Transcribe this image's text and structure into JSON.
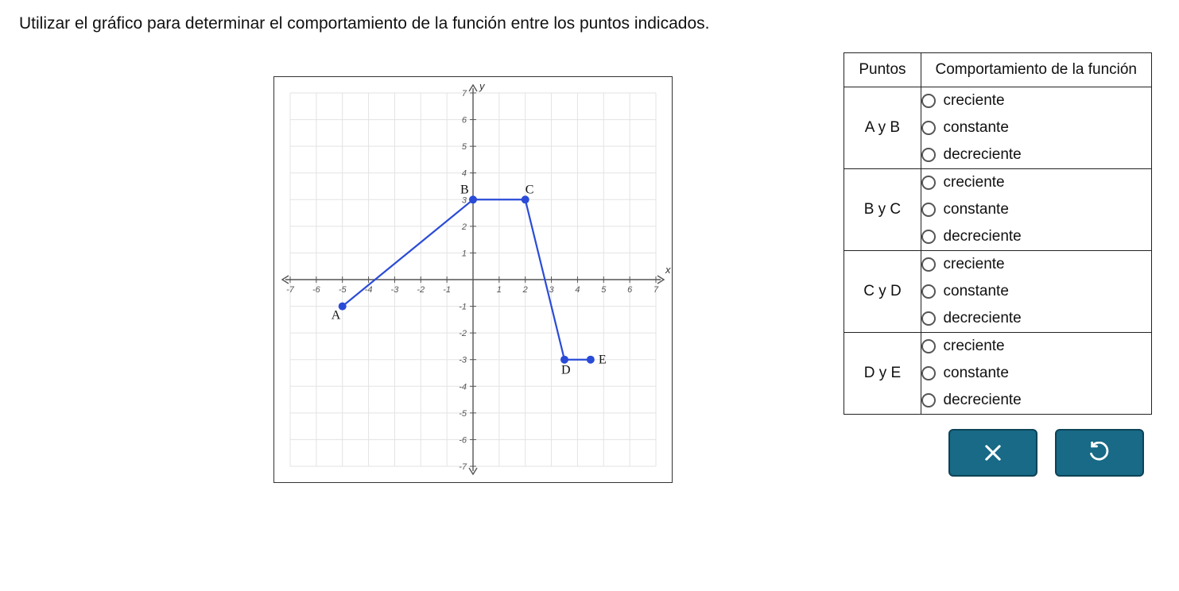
{
  "instruction": "Utilizar el gráfico para determinar el comportamiento de la función entre los puntos indicados.",
  "table": {
    "head_points": "Puntos",
    "head_behavior": "Comportamiento de la función",
    "rows": [
      {
        "points": "A y B",
        "options": [
          "creciente",
          "constante",
          "decreciente"
        ]
      },
      {
        "points": "B y C",
        "options": [
          "creciente",
          "constante",
          "decreciente"
        ]
      },
      {
        "points": "C y D",
        "options": [
          "creciente",
          "constante",
          "decreciente"
        ]
      },
      {
        "points": "D y E",
        "options": [
          "creciente",
          "constante",
          "decreciente"
        ]
      }
    ]
  },
  "buttons": {
    "clear": "×",
    "reset": "↺"
  },
  "chart_data": {
    "type": "line",
    "xlabel": "x",
    "ylabel": "y",
    "xlim": [
      -7,
      7
    ],
    "ylim": [
      -7,
      7
    ],
    "x_ticks": [
      -7,
      -6,
      -5,
      -4,
      -3,
      -2,
      -1,
      1,
      2,
      3,
      4,
      5,
      6,
      7
    ],
    "y_ticks": [
      -7,
      -6,
      -5,
      -4,
      -3,
      -2,
      -1,
      1,
      2,
      3,
      4,
      5,
      6,
      7
    ],
    "points": [
      {
        "name": "A",
        "x": -5,
        "y": -1,
        "label_dx": -14,
        "label_dy": 16
      },
      {
        "name": "B",
        "x": 0,
        "y": 3,
        "label_dx": -16,
        "label_dy": -8
      },
      {
        "name": "C",
        "x": 2,
        "y": 3,
        "label_dx": 0,
        "label_dy": -8
      },
      {
        "name": "D",
        "x": 3.5,
        "y": -3,
        "label_dx": -4,
        "label_dy": 18
      },
      {
        "name": "E",
        "x": 4.5,
        "y": -3,
        "label_dx": 10,
        "label_dy": 5
      }
    ],
    "segments": [
      [
        "A",
        "B"
      ],
      [
        "B",
        "C"
      ],
      [
        "C",
        "D"
      ],
      [
        "D",
        "E"
      ]
    ]
  }
}
